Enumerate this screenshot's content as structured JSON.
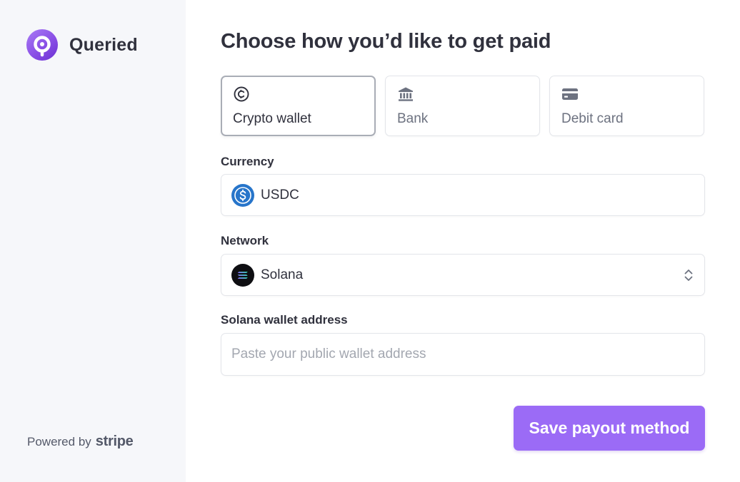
{
  "sidebar": {
    "brand_name": "Queried",
    "powered_by": "Powered by",
    "powered_brand": "stripe"
  },
  "main": {
    "title": "Choose how you’d like to get paid",
    "methods": [
      {
        "label": "Crypto wallet",
        "icon": "crypto-icon",
        "selected": true
      },
      {
        "label": "Bank",
        "icon": "bank-icon",
        "selected": false
      },
      {
        "label": "Debit card",
        "icon": "card-icon",
        "selected": false
      }
    ],
    "currency": {
      "label": "Currency",
      "value": "USDC",
      "icon": "usdc-icon"
    },
    "network": {
      "label": "Network",
      "value": "Solana",
      "icon": "solana-icon"
    },
    "wallet": {
      "label": "Solana wallet address",
      "value": "",
      "placeholder": "Paste your public wallet address"
    },
    "save_label": "Save payout method"
  },
  "colors": {
    "accent": "#9b6bf6",
    "brand_gradient": "#8a4fe6",
    "usdc_blue": "#2775ca",
    "sidebar_bg": "#f6f7fa"
  }
}
